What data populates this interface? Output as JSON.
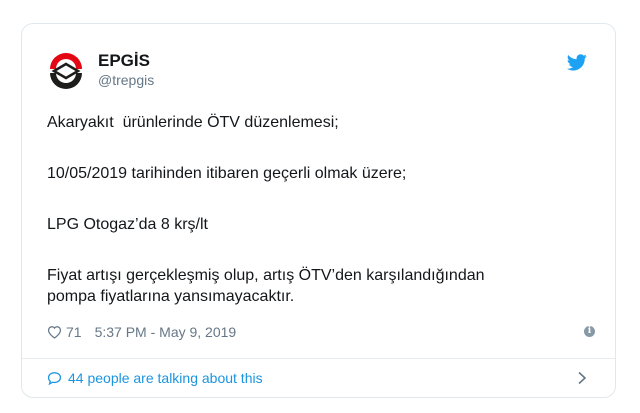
{
  "tweet": {
    "display_name": "EPGİS",
    "handle": "@trepgis",
    "lines": [
      "Akaryakıt  ürünlerinde ÖTV düzenlemesi;",
      "10/05/2019 tarihinden itibaren geçerli olmak üzere;",
      "LPG Otogaz’da 8 krş/lt",
      "Fiyat artışı gerçekleşmiş olup, artış ÖTV’den karşılandığından",
      "pompa fiyatlarına yansımayacaktır."
    ],
    "likes": "71",
    "timestamp": "5:37 PM - May 9, 2019",
    "conversation": "44 people are talking about this",
    "info_symbol": "i"
  },
  "colors": {
    "twitter_blue": "#1da1f2",
    "link_blue": "#1b95e0",
    "logo_red": "#e30613",
    "logo_dark": "#1d1d1b"
  },
  "icons": [
    "epgis-logo",
    "twitter-bird-icon",
    "heart-icon",
    "info-icon",
    "speech-bubble-icon",
    "chevron-right-icon"
  ]
}
